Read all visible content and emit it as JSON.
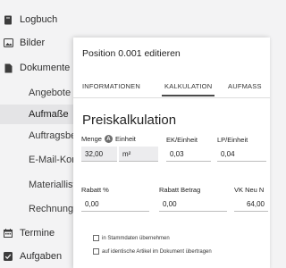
{
  "sidebar": {
    "items": [
      {
        "label": "Logbuch",
        "icon": "notebook-icon"
      },
      {
        "label": "Bilder",
        "icon": "image-icon"
      },
      {
        "label": "Dokumente",
        "icon": "document-icon"
      }
    ],
    "subitems": [
      {
        "label": "Angebote"
      },
      {
        "label": "Aufmaße",
        "active": true
      },
      {
        "label": "Auftragsbestätigungen"
      },
      {
        "label": "E-Mail-Korrespondenz"
      },
      {
        "label": "Materiallisten"
      },
      {
        "label": "Rechnungen"
      }
    ],
    "bottom_items": [
      {
        "label": "Termine",
        "icon": "calendar-icon"
      },
      {
        "label": "Aufgaben",
        "icon": "checkbox-icon"
      }
    ]
  },
  "modal": {
    "title": "Position 0.001 editieren",
    "tabs": [
      "INFORMATIONEN",
      "KALKULATION",
      "AUFMASS"
    ],
    "active_tab": "KALKULATION",
    "section_title": "Preiskalkulation",
    "row1": {
      "labels": {
        "menge": "Menge",
        "einheit": "Einheit",
        "ek": "EK/Einheit",
        "lp": "LP/Einheit"
      },
      "values": {
        "menge": "32,00",
        "einheit": "m²",
        "ek": "0,03",
        "lp": "0,04"
      }
    },
    "row2": {
      "labels": {
        "rabatt_pct": "Rabatt %",
        "rabatt_betrag": "Rabatt Betrag",
        "vk_neu": "VK Neu N"
      },
      "values": {
        "rabatt_pct": "0,00",
        "rabatt_betrag": "0,00",
        "vk_neu": "64,00"
      }
    },
    "checkboxes": [
      {
        "label": "in Stammdaten übernehmen",
        "checked": false
      },
      {
        "label": "auf identische Artikel im Dokument übertragen",
        "checked": false
      }
    ]
  },
  "colors": {
    "sidebar_bg": "#f3f3f4",
    "active_item_bg": "#e4e4e6",
    "modal_bg": "#ffffff",
    "field_bg": "#ececee"
  }
}
